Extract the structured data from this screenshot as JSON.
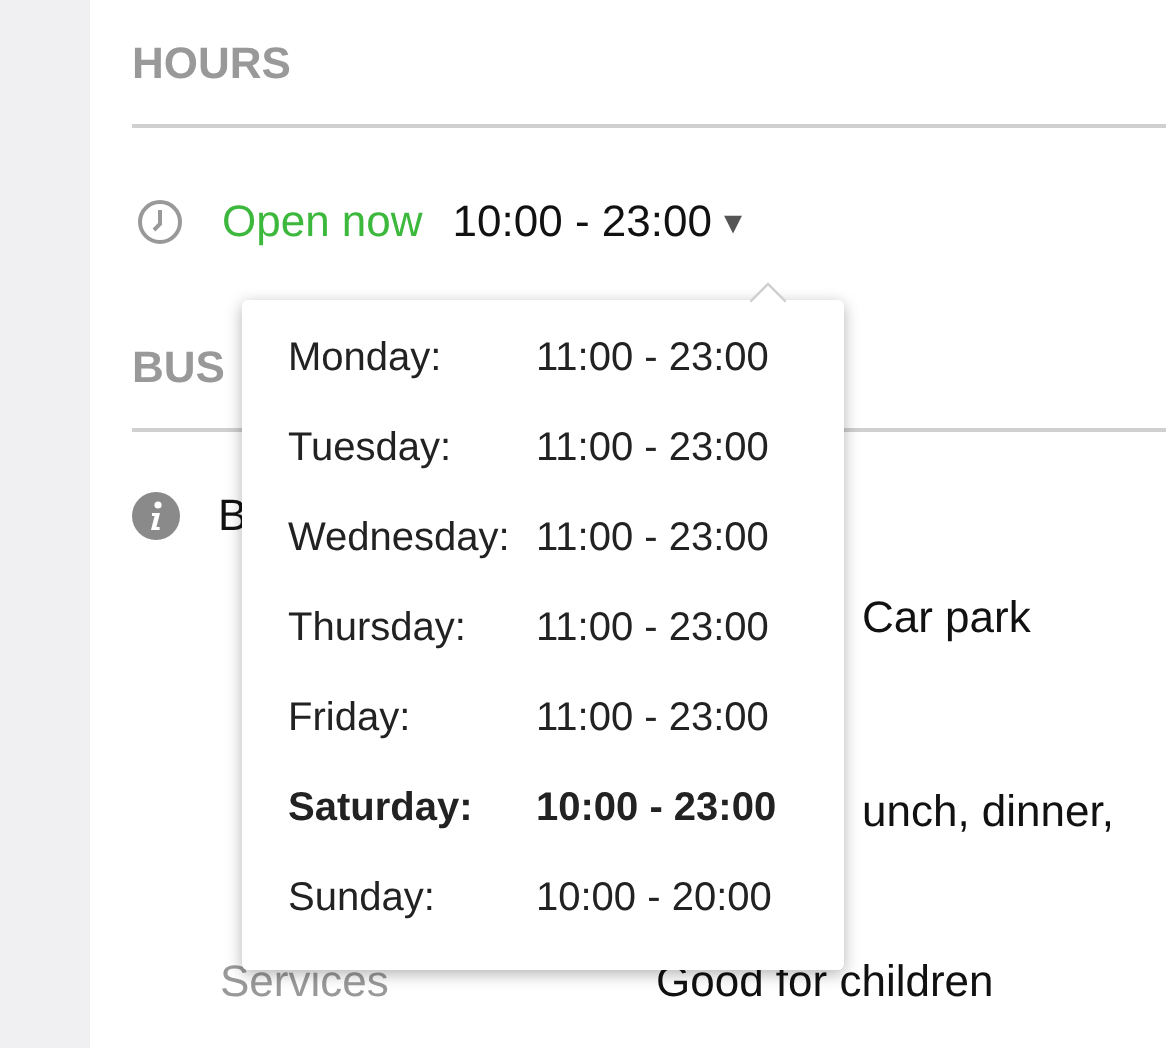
{
  "hours": {
    "heading": "HOURS",
    "status": "Open now",
    "today": "10:00 - 23:00",
    "caret": "▾",
    "days": [
      {
        "day": "Monday:",
        "time": "11:00 - 23:00",
        "selected": false
      },
      {
        "day": "Tuesday:",
        "time": "11:00 - 23:00",
        "selected": false
      },
      {
        "day": "Wednesday:",
        "time": "11:00 - 23:00",
        "selected": false
      },
      {
        "day": "Thursday:",
        "time": "11:00 - 23:00",
        "selected": false
      },
      {
        "day": "Friday:",
        "time": "11:00 - 23:00",
        "selected": false
      },
      {
        "day": "Saturday:",
        "time": "10:00 - 23:00",
        "selected": true
      },
      {
        "day": "Sunday:",
        "time": "10:00 - 20:00",
        "selected": false
      }
    ]
  },
  "business": {
    "heading": "BUS",
    "title": "B",
    "rows": [
      {
        "kind": "cut",
        "value": "Car park"
      },
      {
        "kind": "cut",
        "value": "unch, dinner,"
      },
      {
        "kind": "full",
        "label": "Services",
        "value": "Good for children"
      }
    ]
  }
}
